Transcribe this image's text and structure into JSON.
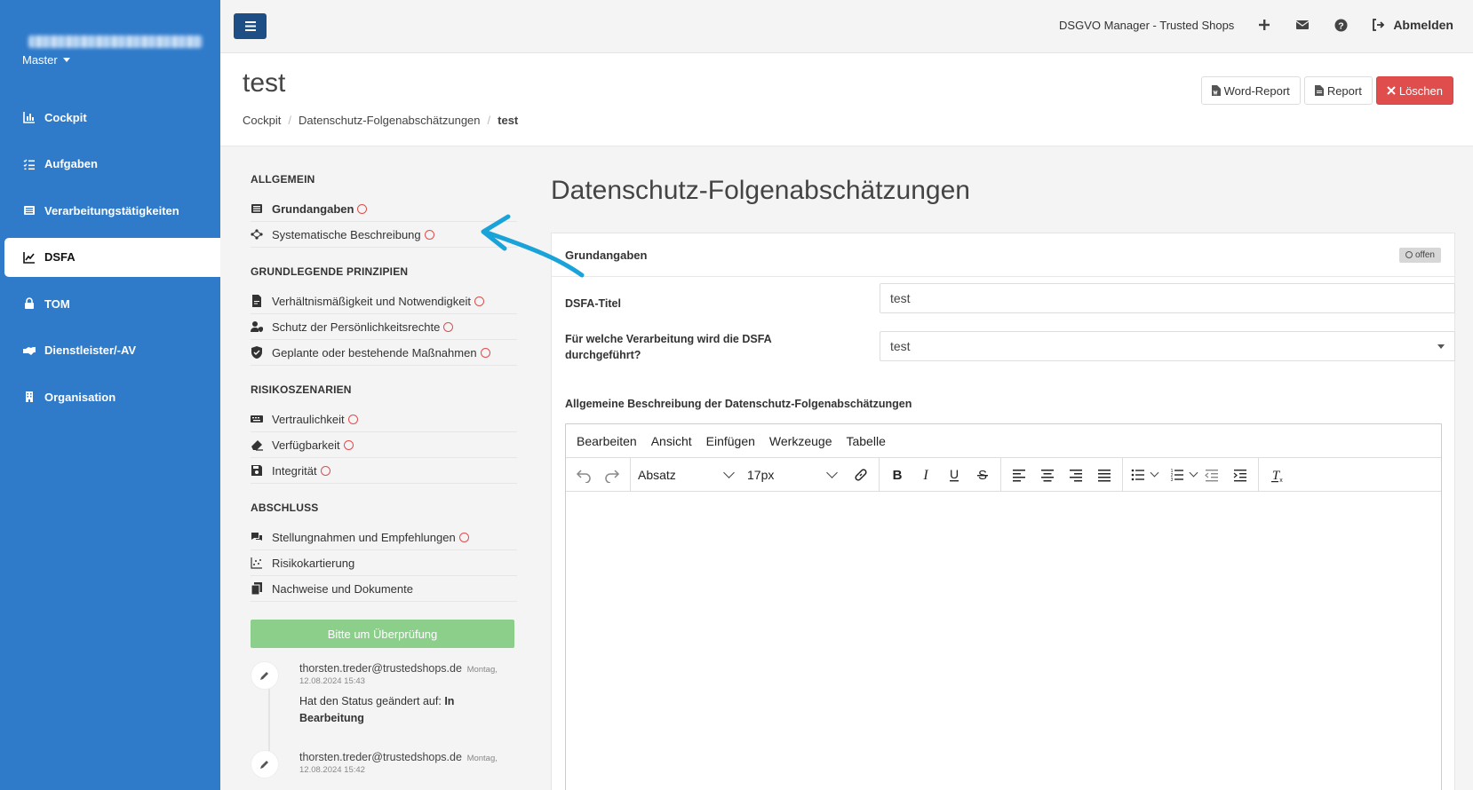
{
  "sidebar": {
    "master_label": "Master",
    "items": [
      {
        "label": "Cockpit",
        "icon": "chart-bar-icon"
      },
      {
        "label": "Aufgaben",
        "icon": "tasks-icon"
      },
      {
        "label": "Verarbeitungstätigkeiten",
        "icon": "list-alt-icon"
      },
      {
        "label": "DSFA",
        "icon": "chart-line-icon",
        "active": true
      },
      {
        "label": "TOM",
        "icon": "lock-icon"
      },
      {
        "label": "Dienstleister/-AV",
        "icon": "handshake-icon"
      },
      {
        "label": "Organisation",
        "icon": "building-icon"
      }
    ]
  },
  "topbar": {
    "app_title": "DSGVO Manager - Trusted Shops",
    "logout_label": "Abmelden"
  },
  "header": {
    "title": "test",
    "breadcrumb": [
      "Cockpit",
      "Datenschutz-Folgenabschätzungen",
      "test"
    ],
    "word_report": "Word-Report",
    "report": "Report",
    "delete": "Löschen"
  },
  "sections": [
    {
      "title": "ALLGEMEIN",
      "items": [
        {
          "label": "Grundangaben",
          "icon": "list-alt-icon",
          "status": true,
          "bold": true
        },
        {
          "label": "Systematische Beschreibung",
          "icon": "project-diagram-icon",
          "status": true
        }
      ]
    },
    {
      "title": "GRUNDLEGENDE PRINZIPIEN",
      "items": [
        {
          "label": "Verhältnismäßigkeit und Notwendigkeit",
          "icon": "file-contract-icon",
          "status": true
        },
        {
          "label": "Schutz der Persönlichkeitsrechte",
          "icon": "user-shield-icon",
          "status": true
        },
        {
          "label": "Geplante oder bestehende Maßnahmen",
          "icon": "shield-check-icon",
          "status": true
        }
      ]
    },
    {
      "title": "RISIKOSZENARIEN",
      "items": [
        {
          "label": "Vertraulichkeit",
          "icon": "keyboard-icon",
          "status": true
        },
        {
          "label": "Verfügbarkeit",
          "icon": "eraser-icon",
          "status": true
        },
        {
          "label": "Integrität",
          "icon": "save-icon",
          "status": true
        }
      ]
    },
    {
      "title": "ABSCHLUSS",
      "items": [
        {
          "label": "Stellungnahmen und Empfehlungen",
          "icon": "comments-icon",
          "status": true
        },
        {
          "label": "Risikokartierung",
          "icon": "scatter-chart-icon",
          "status": false
        },
        {
          "label": "Nachweise und Dokumente",
          "icon": "copy-icon",
          "status": false
        }
      ]
    }
  ],
  "review_button": "Bitte um Überprüfung",
  "timeline": [
    {
      "user": "thorsten.treder@trustedshops.de",
      "day": "Montag,",
      "datetime": "12.08.2024 15:43",
      "text_prefix": "Hat den Status geändert auf:",
      "text_bold": "In Bearbeitung"
    },
    {
      "user": "thorsten.treder@trustedshops.de",
      "day": "Montag,",
      "datetime": "12.08.2024 15:42",
      "text_prefix": "",
      "text_bold": ""
    }
  ],
  "form": {
    "heading": "Datenschutz-Folgenabschätzungen",
    "card_title": "Grundangaben",
    "status_badge": "offen",
    "title_label": "DSFA-Titel",
    "title_value": "test",
    "processing_label": "Für welche Verarbeitung wird die DSFA durchgeführt?",
    "processing_value": "test",
    "description_label": "Allgemeine Beschreibung der Datenschutz-Folgenabschätzungen"
  },
  "editor": {
    "menu": [
      "Bearbeiten",
      "Ansicht",
      "Einfügen",
      "Werkzeuge",
      "Tabelle"
    ],
    "block_format": "Absatz",
    "font_size": "17px"
  },
  "colors": {
    "sidebar": "#2f7ac9",
    "danger": "#e04d4d",
    "success": "#8bcf8b",
    "annotation_arrow": "#1aa3d9"
  }
}
